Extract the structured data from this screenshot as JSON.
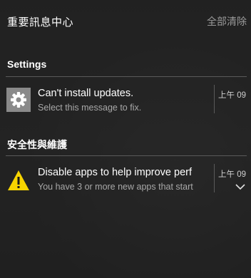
{
  "header": {
    "title": "重要訊息中心",
    "clear_all": "全部清除"
  },
  "groups": [
    {
      "title": "Settings",
      "icon": "gear-icon",
      "notification": {
        "title": "Can't install updates.",
        "body": "Select this message to fix.",
        "time": "上午 09"
      }
    },
    {
      "title": "安全性與維護",
      "icon": "warning-icon",
      "notification": {
        "title": "Disable apps to help improve perf",
        "body": "You have 3 or more new apps that start",
        "time": "上午 09",
        "expand_icon": "chevron-down-icon"
      }
    }
  ],
  "colors": {
    "background": "#2c2c2c",
    "divider": "#5a5a5a",
    "secondary_text": "#a8a8a8",
    "warning": "#f7d400",
    "gear_tile": "#8a8a8a"
  }
}
